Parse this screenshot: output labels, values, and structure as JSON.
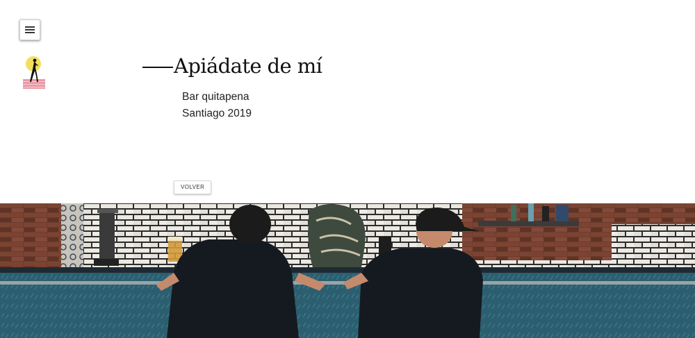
{
  "nav": {
    "menu_icon": "hamburger-menu-icon"
  },
  "brand": {
    "logo_icon": "running-figure-sun-logo",
    "colors": {
      "sun": "#f3df5c",
      "stripes": "#e89aa5"
    }
  },
  "header": {
    "title": "Apiádate de mí",
    "subtitle_line1": "Bar quitapena",
    "subtitle_line2": "Santiago 2019"
  },
  "actions": {
    "back_label": "VOLVER"
  },
  "hero": {
    "image": "bar-patrons-photo",
    "colors": {
      "counter": "#27596a",
      "brick": "#6e3b2b",
      "tile": "#e9e6e0"
    }
  }
}
